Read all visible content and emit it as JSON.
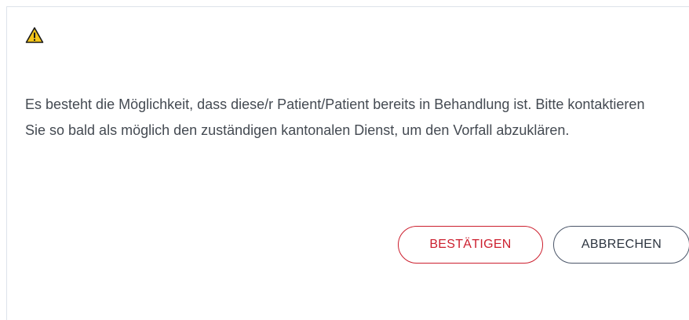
{
  "dialog": {
    "icon": "warning-icon",
    "message": "Es besteht die Möglichkeit, dass diese/r Patient/Patient bereits in Behandlung ist. Bitte kontaktieren Sie so bald als möglich den zuständigen kantonalen Dienst, um den Vorfall abzuklären.",
    "confirm_label": "BESTÄTIGEN",
    "cancel_label": "ABBRECHEN"
  },
  "colors": {
    "confirm": "#cc1f2e",
    "cancel": "#4a5568",
    "warning_fill": "#f5c518",
    "text": "#444a52"
  }
}
